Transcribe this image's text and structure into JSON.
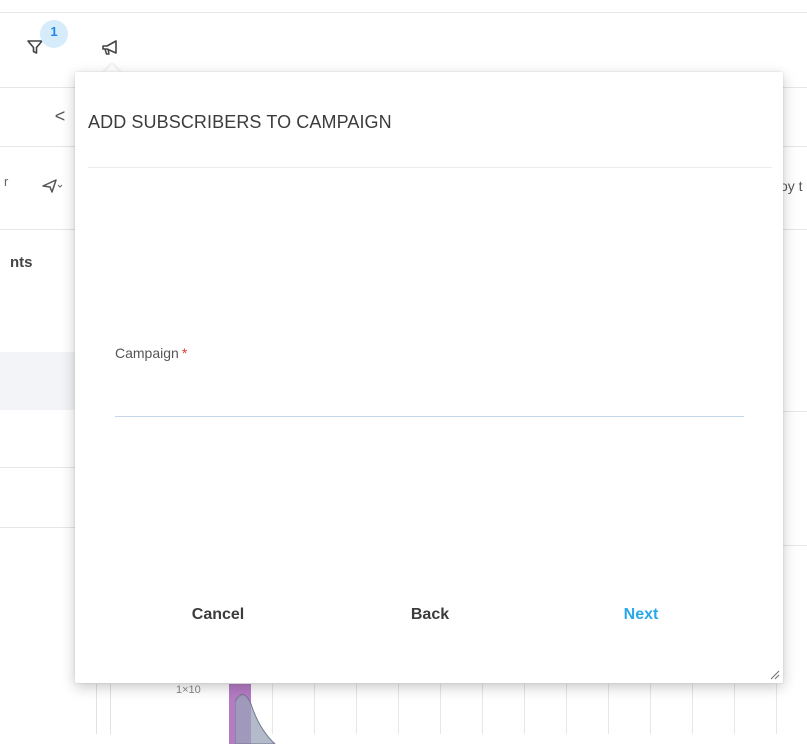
{
  "toolbar": {
    "filter_badge_count": "1",
    "filter_icon": "filter-icon",
    "campaign_icon": "megaphone-icon"
  },
  "background": {
    "back_icon": "chevron-left-icon",
    "back_glyph": "<",
    "left_tool_text": "r",
    "right_clipped_text": "oy t",
    "left_label": "nts",
    "chart_axis_label": "1×10"
  },
  "dialog": {
    "title": "ADD SUBSCRIBERS TO CAMPAIGN",
    "campaign_label": "Campaign",
    "required_marker": "*",
    "campaign_value": "",
    "buttons": {
      "cancel": "Cancel",
      "back": "Back",
      "next": "Next"
    },
    "accent_color": "#29a8e8",
    "required_color": "#e53935"
  }
}
